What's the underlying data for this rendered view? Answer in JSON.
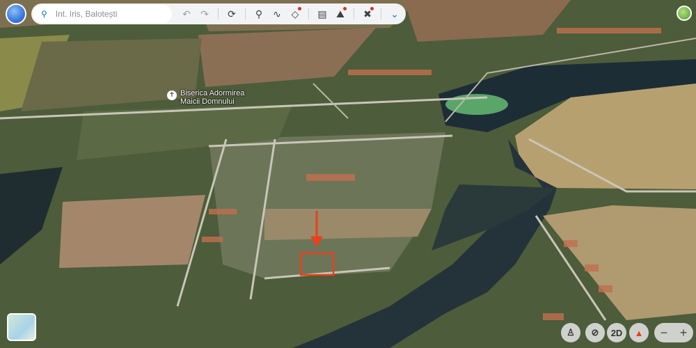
{
  "search": {
    "placeholder": "Int. Iris, Balotești"
  },
  "toolbar": {
    "undo": "↶",
    "redo": "↷",
    "items": [
      "history-icon",
      "placemark-icon",
      "path-icon",
      "layers-icon",
      "measure-icon",
      "image-overlay-icon",
      "tools-icon",
      "chevron-down-icon"
    ]
  },
  "poi": {
    "line1": "Biserica Adormirea",
    "line2": "Maicii Domnului"
  },
  "controls": {
    "view_2d": "2D",
    "zoom_out": "−",
    "zoom_in": "+"
  },
  "colors": {
    "marker": "#e8401c",
    "badge": "#d93025"
  }
}
